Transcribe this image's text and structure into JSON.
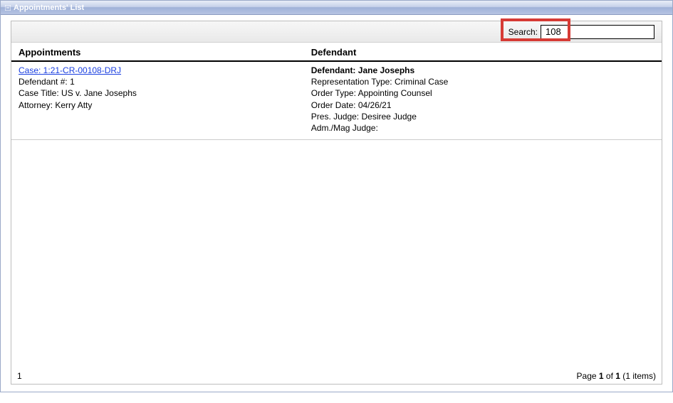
{
  "panel": {
    "title": "Appointments' List"
  },
  "search": {
    "label": "Search:",
    "value": "108"
  },
  "columns": {
    "left": "Appointments",
    "right": "Defendant"
  },
  "rows": [
    {
      "case_link": "Case: 1:21-CR-00108-DRJ",
      "defendant_num_label": "Defendant #:",
      "defendant_num": "1",
      "case_title_label": "Case Title:",
      "case_title": "US v. Jane Josephs",
      "attorney_label": "Attorney:",
      "attorney": "Kerry Atty",
      "defendant_label": "Defendant:",
      "defendant_name": "Jane Josephs",
      "rep_type_label": "Representation Type:",
      "rep_type": "Criminal Case",
      "order_type_label": "Order Type:",
      "order_type": "Appointing Counsel",
      "order_date_label": "Order Date:",
      "order_date": "04/26/21",
      "pres_judge_label": "Pres. Judge:",
      "pres_judge": "Desiree Judge",
      "adm_judge_label": "Adm./Mag Judge:",
      "adm_judge": ""
    }
  ],
  "pager": {
    "current_page": "1",
    "total_pages": "1",
    "item_count": "1",
    "page_label_prefix": "Page ",
    "page_label_of": " of ",
    "items_label_prefix": " (",
    "items_label_suffix": " items)",
    "left_page": "1"
  }
}
